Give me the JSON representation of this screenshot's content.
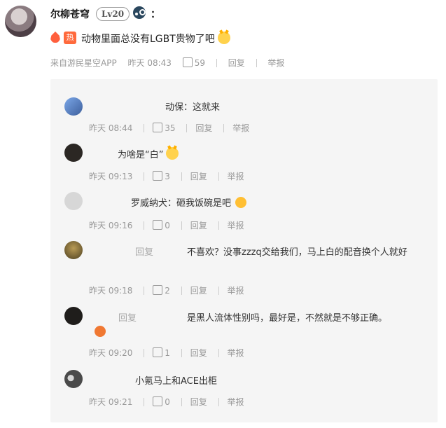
{
  "post": {
    "username": "尔柳苍穹",
    "level": "Lv20",
    "colon": "：",
    "hot_badge": "热",
    "text": "动物里面总没有LGBT贵物了吧",
    "source": "来自游民星空APP",
    "time": "昨天 08:43",
    "likes": "59",
    "reply": "回复",
    "report": "举报"
  },
  "replies": [
    {
      "name": "",
      "text": "动保：这就来",
      "time": "昨天 08:44",
      "likes": "35",
      "reply": "回复",
      "report": "举报"
    },
    {
      "name": "",
      "text": "为啥是“白”",
      "time": "昨天 09:13",
      "likes": "3",
      "reply": "回复",
      "report": "举报"
    },
    {
      "name": "",
      "text": "罗威纳犬：砸我饭碗是吧",
      "time": "昨天 09:16",
      "likes": "0",
      "reply": "回复",
      "report": "举报"
    },
    {
      "name": "",
      "reply_label": "回复",
      "text": "不喜欢？没事zzzq交给我们，马上白的配音换个人就好",
      "time": "昨天 09:18",
      "likes": "2",
      "reply": "回复",
      "report": "举报"
    },
    {
      "name": "",
      "reply_label": "回复",
      "text": "是黑人流体性别吗，最好是，不然就是不够正确。",
      "time": "昨天 09:20",
      "likes": "1",
      "reply": "回复",
      "report": "举报"
    },
    {
      "name": "",
      "text": "小氪马上和ACE出柜",
      "time": "昨天 09:21",
      "likes": "0",
      "reply": "回复",
      "report": "举报"
    }
  ],
  "icons": {
    "steam": "steam-icon",
    "fire": "fire-icon",
    "like": "thumbs-up-icon",
    "cat": "cat-face-icon",
    "sticker": "sticker-icon"
  },
  "colors": {
    "accent": "#ff6a3d",
    "meta": "#999999",
    "panel": "#f5f5f5"
  }
}
